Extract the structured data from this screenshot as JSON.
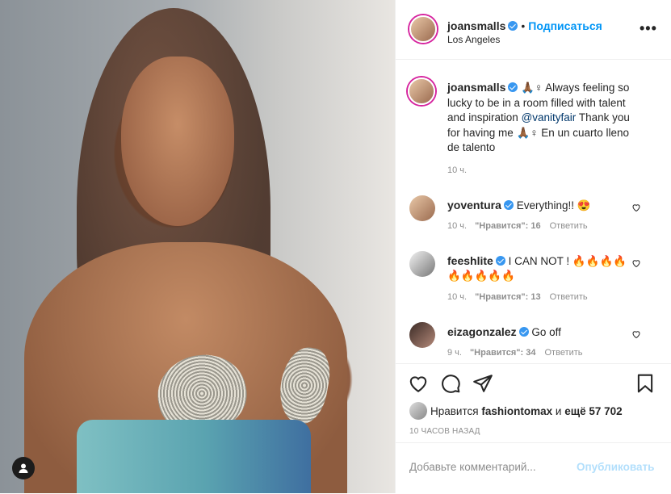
{
  "post": {
    "author": "joansmalls",
    "follow_label": "Подписаться",
    "location": "Los Angeles",
    "more_label": "•••",
    "caption_emoji": "🙏🏾♀",
    "caption_text": "Always feeling so lucky to be in a room filled with talent and inspiration",
    "caption_mention": "@vanityfair",
    "caption_text2": "Thank you for having me 🙏🏾♀ En un cuarto lleno de talento",
    "caption_time": "10 ч."
  },
  "comments": [
    {
      "user": "yoventura",
      "text": "Everything!! 😍",
      "time": "10 ч.",
      "likes": "\"Нравится\": 16",
      "reply": "Ответить"
    },
    {
      "user": "feeshlite",
      "text": "I CAN NOT ! 🔥🔥🔥🔥 🔥🔥🔥🔥🔥",
      "time": "10 ч.",
      "likes": "\"Нравится\": 13",
      "reply": "Ответить"
    },
    {
      "user": "eizagonzalez",
      "text": "Go off",
      "time": "9 ч.",
      "likes": "\"Нравится\": 34",
      "reply": "Ответить"
    }
  ],
  "likes_line": {
    "prefix": "Нравится",
    "user": "fashiontomax",
    "middle": "и",
    "count": "ещё 57 702"
  },
  "posted_ago": "10 ЧАСОВ НАЗАД",
  "add_comment": {
    "placeholder": "Добавьте комментарий...",
    "publish": "Опубликовать"
  },
  "icons": [
    "user-tag-icon",
    "verified-icon",
    "more-icon",
    "heart-icon",
    "comment-icon",
    "share-icon",
    "save-icon"
  ],
  "colors": {
    "follow": "#0095f6",
    "verified": "#3897f0",
    "publish_disabled": "#b2dffc",
    "muted": "#8e8e8e"
  }
}
